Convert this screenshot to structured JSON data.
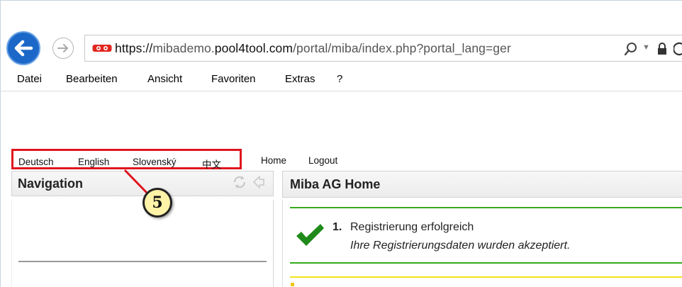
{
  "browser": {
    "url_parts": {
      "prefix": "https://",
      "sub": "mibademo.",
      "domain": "pool4tool.com",
      "path": "/portal/miba/index.php?portal_lang=ger"
    }
  },
  "menu": {
    "items": [
      {
        "label": "Datei"
      },
      {
        "label": "Bearbeiten"
      },
      {
        "label": "Ansicht"
      },
      {
        "label": "Favoriten"
      },
      {
        "label": "Extras"
      },
      {
        "label": "?"
      }
    ]
  },
  "languages": [
    {
      "label": "Deutsch"
    },
    {
      "label": "English"
    },
    {
      "label": "Slovenský"
    },
    {
      "label": "中文"
    }
  ],
  "top_links": {
    "home": "Home",
    "logout": "Logout"
  },
  "navigation": {
    "title": "Navigation"
  },
  "main": {
    "title": "Miba AG Home",
    "message": {
      "number": "1.",
      "title": "Registrierung erfolgreich",
      "subtitle": "Ihre Registrierungsdaten wurden akzeptiert."
    }
  },
  "annotation": {
    "callout_label": "5",
    "callout_color": "#fff3a8",
    "highlight_color": "#e0161e"
  },
  "colors": {
    "success": "#36a91c",
    "warning": "#f2e21b",
    "back_button": "#1c68c8"
  }
}
